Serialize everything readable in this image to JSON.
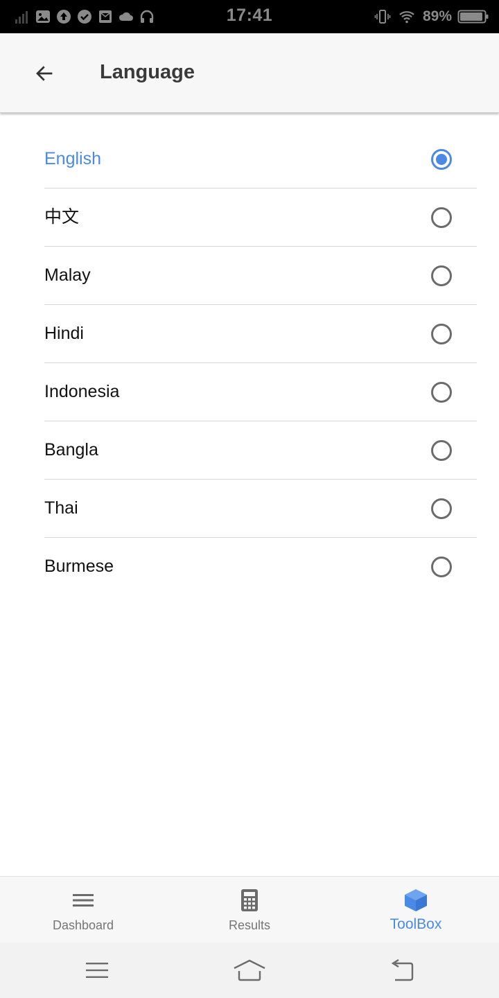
{
  "status_bar": {
    "time": "17:41",
    "battery_percent": "89%",
    "left_icons": [
      "signal-icon",
      "image-icon",
      "upload-icon",
      "check-circle-icon",
      "mail-icon",
      "cloud-icon",
      "headphones-icon"
    ],
    "right_icons": [
      "vibrate-icon",
      "wifi-icon",
      "battery-icon"
    ]
  },
  "app_bar": {
    "title": "Language",
    "back_icon": "arrow-left-icon"
  },
  "languages": {
    "selected_index": 0,
    "items": [
      {
        "label": "English",
        "selected": true
      },
      {
        "label": "中文",
        "selected": false
      },
      {
        "label": "Malay",
        "selected": false
      },
      {
        "label": "Hindi",
        "selected": false
      },
      {
        "label": "Indonesia",
        "selected": false
      },
      {
        "label": "Bangla",
        "selected": false
      },
      {
        "label": "Thai",
        "selected": false
      },
      {
        "label": "Burmese",
        "selected": false
      }
    ]
  },
  "bottom_nav": {
    "active_index": 2,
    "items": [
      {
        "label": "Dashboard",
        "icon": "menu-icon"
      },
      {
        "label": "Results",
        "icon": "calculator-icon"
      },
      {
        "label": "ToolBox",
        "icon": "cube-icon"
      }
    ]
  },
  "system_nav": {
    "icons": [
      "menu-icon",
      "home-icon",
      "back-icon"
    ]
  },
  "colors": {
    "accent": "#4a8ae6",
    "status_bar_bg": "#000000",
    "app_bar_bg": "#f7f7f7",
    "text_primary": "#111111",
    "text_secondary": "#757575",
    "divider": "#d8d8d8",
    "radio_unselected": "#6b6b6b"
  }
}
